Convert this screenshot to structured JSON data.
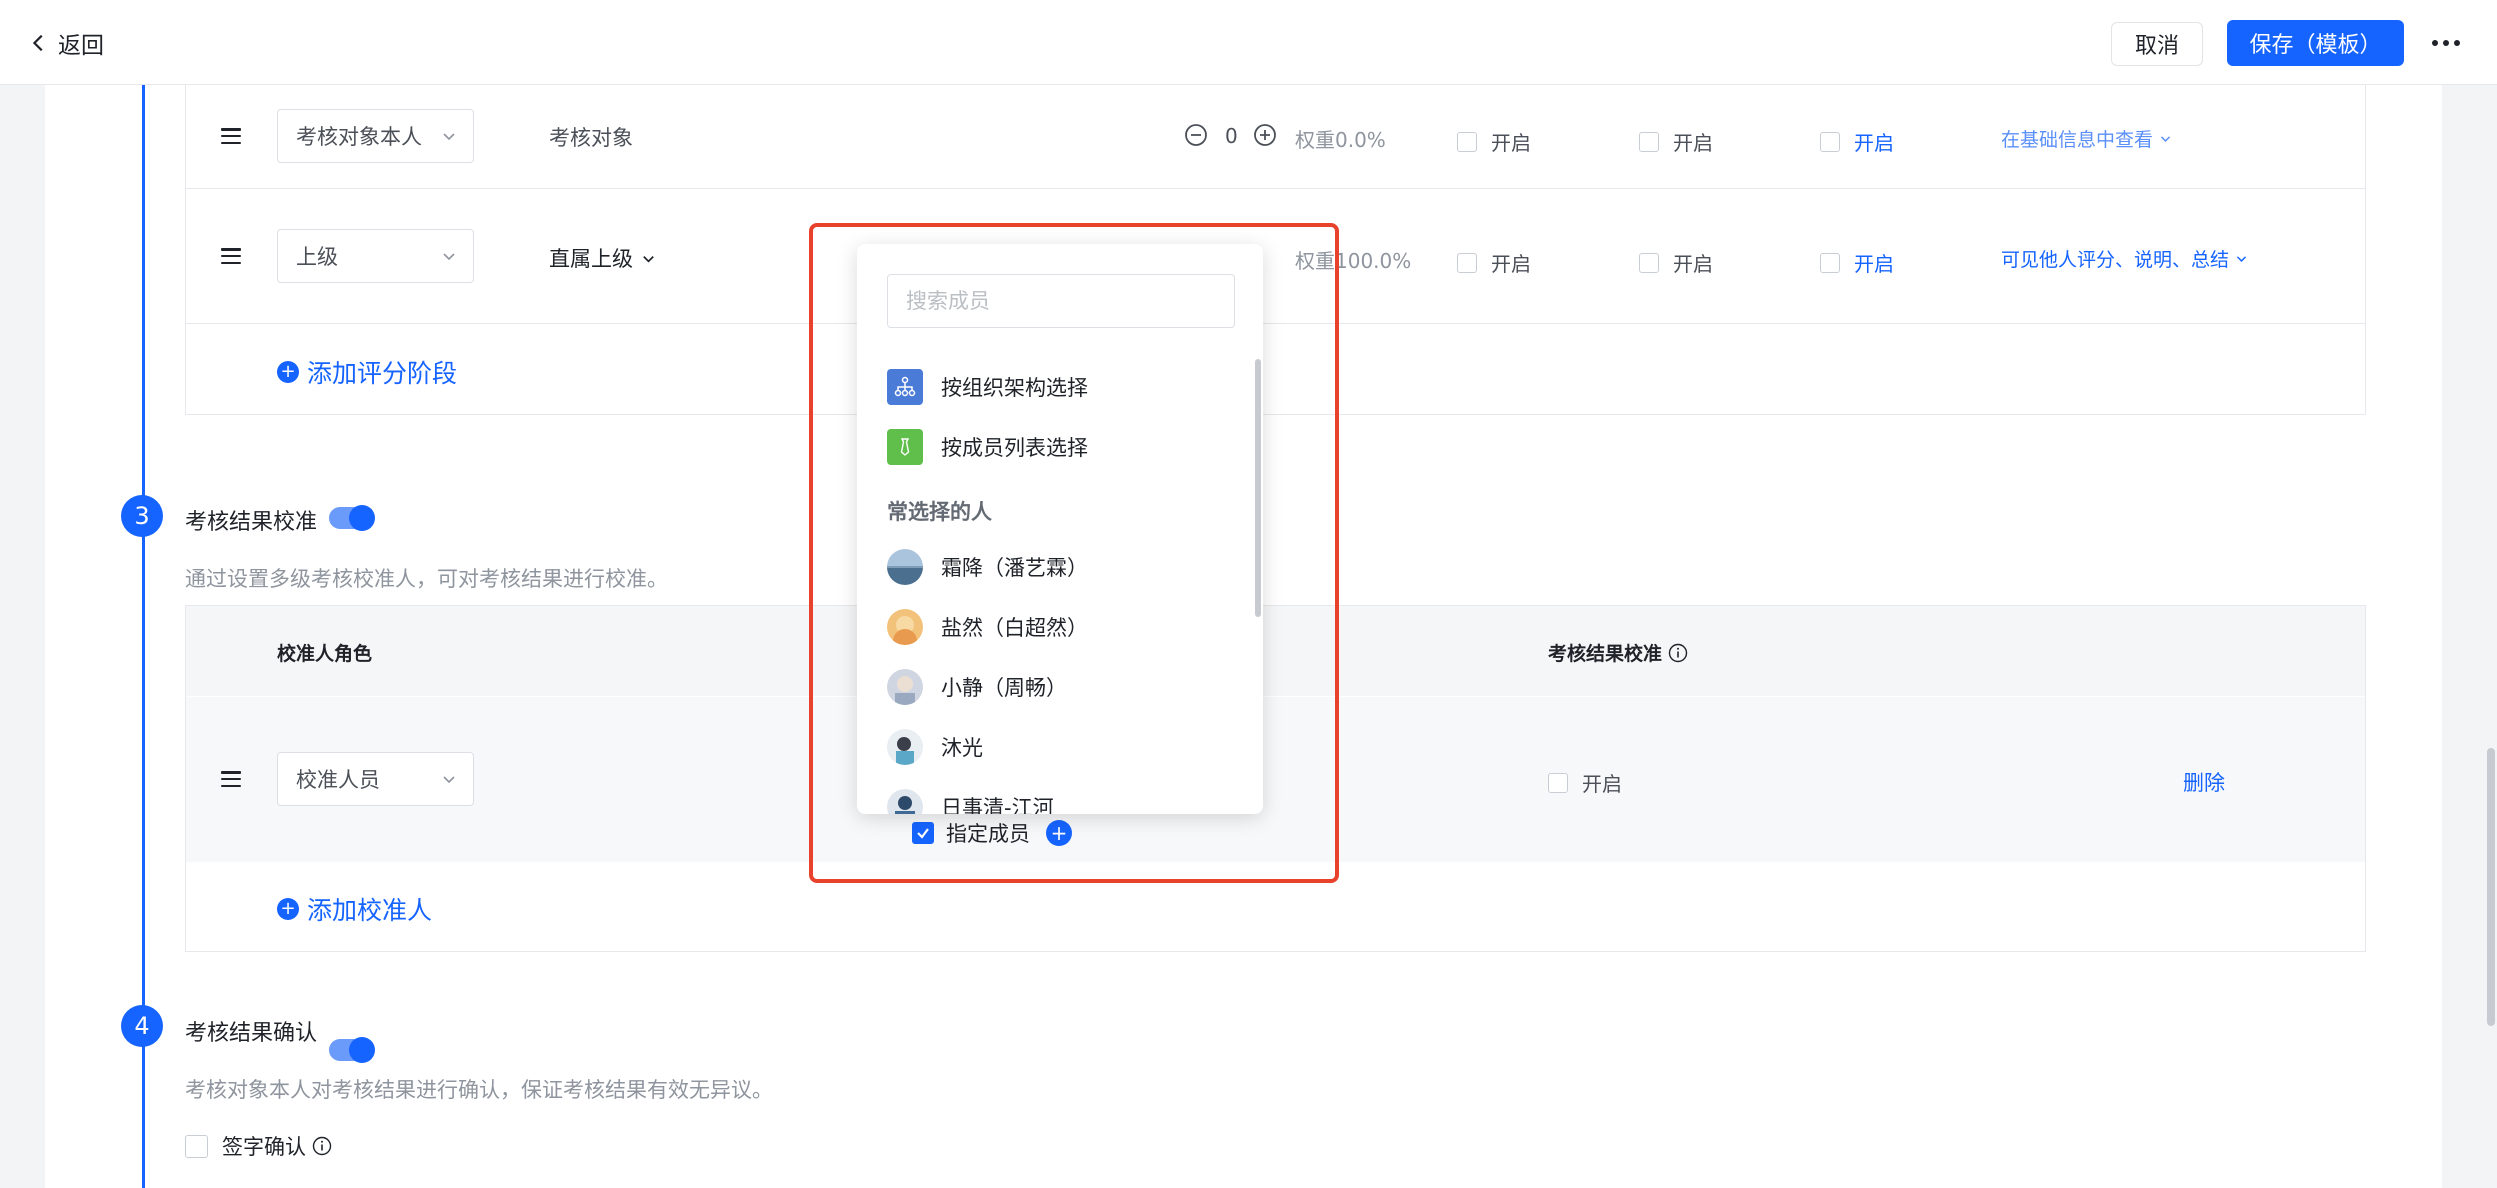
{
  "topbar": {
    "back_label": "返回",
    "cancel_label": "取消",
    "save_label": "保存（模板）"
  },
  "rating_stages": {
    "rows": [
      {
        "role": "考核对象本人",
        "rater": "考核对象",
        "weight_value": "0",
        "weight_label": "权重0.0%",
        "option1": "开启",
        "option2": "开启",
        "option3": "开启",
        "visibility": "在基础信息中查看"
      },
      {
        "role": "上级",
        "rater": "直属上级",
        "weight_label": "权重100.0%",
        "option1": "开启",
        "option2": "开启",
        "option3": "开启",
        "visibility": "可见他人评分、说明、总结"
      }
    ],
    "add_label": "添加评分阶段"
  },
  "section3": {
    "number": "3",
    "title": "考核结果校准",
    "description": "通过设置多级考核校准人，可对考核结果进行校准。",
    "head_role": "校准人角色",
    "head_calibration": "考核结果校准",
    "row": {
      "role": "校准人员",
      "assigned_label": "指定成员",
      "calibration_option": "开启",
      "delete_label": "删除"
    },
    "add_label": "添加校准人"
  },
  "section4": {
    "number": "4",
    "title": "考核结果确认",
    "description": "考核对象本人对考核结果进行确认，保证考核结果有效无异议。",
    "sign_label": "签字确认"
  },
  "member_picker": {
    "search_placeholder": "搜索成员",
    "by_org": "按组织架构选择",
    "by_list": "按成员列表选择",
    "frequent_title": "常选择的人",
    "members": [
      {
        "name": "霜降（潘艺霖）"
      },
      {
        "name": "盐然（白超然）"
      },
      {
        "name": "小静（周畅）"
      },
      {
        "name": "沐光"
      },
      {
        "name": "日事清-江河"
      }
    ]
  },
  "colors": {
    "primary": "#1664ff",
    "highlight": "#e8412c"
  }
}
